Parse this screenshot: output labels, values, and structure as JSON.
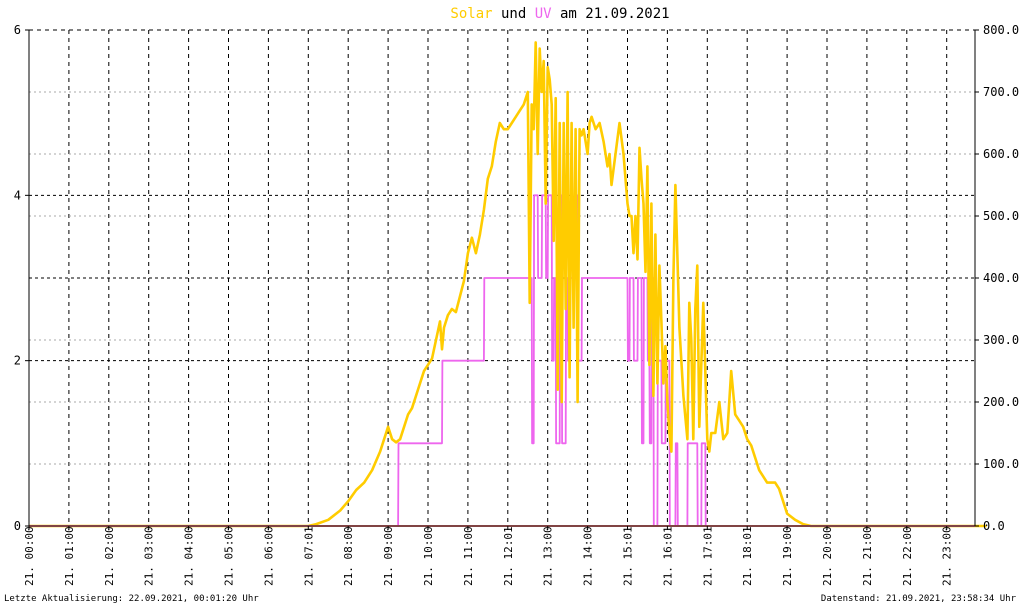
{
  "title": {
    "solar": "Solar",
    "und": " und ",
    "uv": "UV",
    "rest": " am 21.09.2021"
  },
  "footer": {
    "left": "Letzte Aktualisierung: 22.09.2021, 00:01:20 Uhr",
    "right": "Datenstand: 21.09.2021, 23:58:34 Uhr"
  },
  "colors": {
    "solar": "#ffcc00",
    "uv": "#ee66ee",
    "axis": "#000000",
    "grid": "#000000",
    "baseline": "#ff8888"
  },
  "chart_data": {
    "type": "line",
    "grid": true,
    "x_ticks": [
      "21. 00:00",
      "21. 01:00",
      "21. 02:00",
      "21. 03:00",
      "21. 04:00",
      "21. 05:00",
      "21. 06:00",
      "21. 07:01",
      "21. 08:00",
      "21. 09:00",
      "21. 10:00",
      "21. 11:00",
      "21. 12:01",
      "21. 13:00",
      "21. 14:00",
      "21. 15:01",
      "21. 16:01",
      "21. 17:01",
      "21. 18:01",
      "21. 19:00",
      "21. 20:00",
      "21. 21:00",
      "21. 22:00",
      "21. 23:00"
    ],
    "left_axis": {
      "min": 0,
      "max": 6,
      "ticks": [
        "0",
        "2",
        "4",
        "6"
      ]
    },
    "right_axis": {
      "min": 0,
      "max": 800,
      "ticks": [
        "0.0",
        "100.0",
        "200.0",
        "300.0",
        "400.0",
        "500.0",
        "600.0",
        "700.0",
        "800.0"
      ]
    },
    "series": [
      {
        "name": "Solar",
        "axis": "right",
        "x": [
          0,
          7.0,
          7.2,
          7.5,
          7.8,
          8.0,
          8.2,
          8.4,
          8.6,
          8.8,
          9.0,
          9.1,
          9.2,
          9.3,
          9.5,
          9.6,
          9.75,
          9.85,
          9.9,
          10.0,
          10.1,
          10.2,
          10.3,
          10.35,
          10.4,
          10.5,
          10.6,
          10.7,
          10.8,
          10.9,
          11.0,
          11.1,
          11.2,
          11.3,
          11.4,
          11.5,
          11.6,
          11.7,
          11.8,
          11.9,
          12.0,
          12.1,
          12.2,
          12.3,
          12.4,
          12.5,
          12.55,
          12.6,
          12.65,
          12.7,
          12.75,
          12.8,
          12.85,
          12.9,
          12.95,
          13.0,
          13.05,
          13.1,
          13.15,
          13.2,
          13.25,
          13.3,
          13.35,
          13.4,
          13.45,
          13.5,
          13.55,
          13.6,
          13.65,
          13.7,
          13.75,
          13.8,
          13.85,
          13.9,
          14.0,
          14.05,
          14.1,
          14.2,
          14.3,
          14.4,
          14.5,
          14.55,
          14.6,
          14.7,
          14.8,
          14.9,
          15.0,
          15.05,
          15.1,
          15.15,
          15.2,
          15.25,
          15.3,
          15.35,
          15.4,
          15.45,
          15.5,
          15.55,
          15.6,
          15.65,
          15.7,
          15.75,
          15.8,
          15.85,
          15.9,
          15.95,
          16.0,
          16.05,
          16.1,
          16.15,
          16.2,
          16.3,
          16.4,
          16.5,
          16.55,
          16.6,
          16.65,
          16.7,
          16.75,
          16.8,
          16.9,
          17.0,
          17.05,
          17.1,
          17.2,
          17.3,
          17.4,
          17.5,
          17.6,
          17.7,
          17.8,
          17.9,
          18.0,
          18.1,
          18.2,
          18.3,
          18.4,
          18.5,
          18.6,
          18.7,
          18.8,
          18.9,
          19.0,
          19.2,
          19.4,
          19.6,
          24
        ],
        "values": [
          0,
          0,
          3,
          10,
          25,
          40,
          58,
          70,
          90,
          120,
          160,
          140,
          135,
          140,
          180,
          190,
          220,
          240,
          250,
          260,
          270,
          300,
          330,
          285,
          320,
          340,
          350,
          345,
          370,
          395,
          440,
          465,
          440,
          470,
          510,
          560,
          580,
          620,
          650,
          640,
          640,
          650,
          660,
          670,
          680,
          700,
          360,
          680,
          640,
          780,
          600,
          770,
          700,
          750,
          520,
          740,
          720,
          680,
          460,
          690,
          220,
          650,
          200,
          650,
          350,
          700,
          240,
          650,
          320,
          640,
          200,
          640,
          630,
          640,
          600,
          650,
          660,
          640,
          650,
          620,
          580,
          600,
          550,
          600,
          650,
          600,
          520,
          500,
          500,
          440,
          500,
          430,
          610,
          560,
          520,
          410,
          580,
          260,
          520,
          210,
          470,
          230,
          420,
          330,
          230,
          290,
          200,
          150,
          120,
          400,
          550,
          320,
          210,
          140,
          360,
          300,
          140,
          350,
          420,
          160,
          360,
          140,
          120,
          150,
          150,
          200,
          140,
          150,
          250,
          180,
          170,
          160,
          140,
          130,
          110,
          90,
          80,
          70,
          70,
          70,
          60,
          40,
          20,
          10,
          3,
          0,
          0
        ]
      },
      {
        "name": "UV",
        "axis": "left",
        "x": [
          0,
          9.25,
          9.26,
          10.35,
          10.36,
          11.4,
          11.41,
          12.6,
          12.61,
          12.65,
          12.66,
          12.75,
          12.76,
          12.85,
          12.86,
          12.95,
          12.96,
          13.0,
          13.01,
          13.1,
          13.11,
          13.15,
          13.16,
          13.2,
          13.21,
          13.3,
          13.31,
          13.35,
          13.36,
          13.45,
          13.46,
          13.5,
          13.51,
          13.55,
          13.56,
          13.7,
          13.71,
          13.75,
          13.76,
          13.85,
          13.86,
          15.0,
          15.01,
          15.05,
          15.06,
          15.15,
          15.16,
          15.25,
          15.26,
          15.35,
          15.36,
          15.4,
          15.41,
          15.5,
          15.51,
          15.55,
          15.56,
          15.6,
          15.61,
          15.65,
          15.66,
          15.75,
          15.76,
          15.85,
          15.86,
          15.95,
          15.96,
          16.05,
          16.06,
          16.2,
          16.21,
          16.25,
          16.26,
          16.5,
          16.51,
          16.75,
          16.76,
          16.85,
          16.86,
          16.95,
          16.96,
          17.0,
          17.01,
          24
        ],
        "values": [
          0,
          0,
          1,
          1,
          2,
          2,
          3,
          3,
          1,
          1,
          4,
          4,
          3,
          3,
          4,
          4,
          3,
          3,
          4,
          4,
          2,
          2,
          3,
          3,
          1,
          1,
          4,
          4,
          1,
          1,
          3,
          3,
          2,
          2,
          3,
          3,
          4,
          4,
          2,
          2,
          3,
          3,
          2,
          2,
          3,
          3,
          2,
          2,
          3,
          3,
          1,
          1,
          3,
          3,
          2,
          2,
          1,
          1,
          3,
          3,
          0,
          0,
          2,
          2,
          1,
          1,
          2,
          2,
          0,
          0,
          1,
          1,
          0,
          0,
          1,
          1,
          0,
          0,
          1,
          1,
          0,
          0,
          0,
          0
        ]
      }
    ]
  }
}
